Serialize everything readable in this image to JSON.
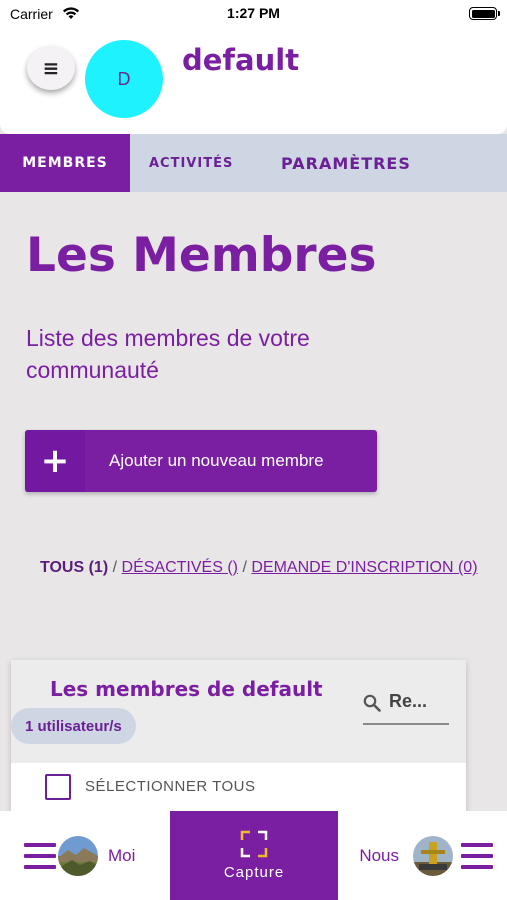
{
  "status_bar": {
    "carrier": "Carrier",
    "time": "1:27 PM"
  },
  "header": {
    "avatar_letter": "D",
    "community_name": "default",
    "menu_glyph": "≡"
  },
  "tabs": [
    {
      "label": "MEMBRES",
      "active": true
    },
    {
      "label": "ACTIVITÉS",
      "active": false
    },
    {
      "label": "PARAMÈTRES",
      "active": false
    }
  ],
  "main": {
    "title": "Les Membres",
    "subtitle": "Liste des membres de votre communauté",
    "add_button": {
      "icon": "+",
      "label": "Ajouter un nouveau membre"
    },
    "filters": {
      "all": "TOUS (1)",
      "deactivated": "DÉSACTIVÉS ()",
      "requests": "DEMANDE D'INSCRIPTION (0)",
      "separator": "/"
    }
  },
  "card": {
    "title": "Les membres de default",
    "search_text": "Re...",
    "user_count": "1 utilisateur/s",
    "select_all": "SÉLECTIONNER TOUS"
  },
  "bottom_nav": {
    "me_label": "Moi",
    "capture_label": "Capture",
    "us_label": "Nous"
  },
  "colors": {
    "brand_purple": "#7b1fa2",
    "tab_bar_bg": "#cdd6e2",
    "avatar_bg": "#1ef2ff",
    "page_bg": "#e8e6e6"
  },
  "icons": [
    "wifi-icon",
    "battery-icon",
    "menu-icon",
    "plus-icon",
    "search-icon",
    "checkbox-icon",
    "hamburger-icon",
    "capture-frame-icon"
  ]
}
